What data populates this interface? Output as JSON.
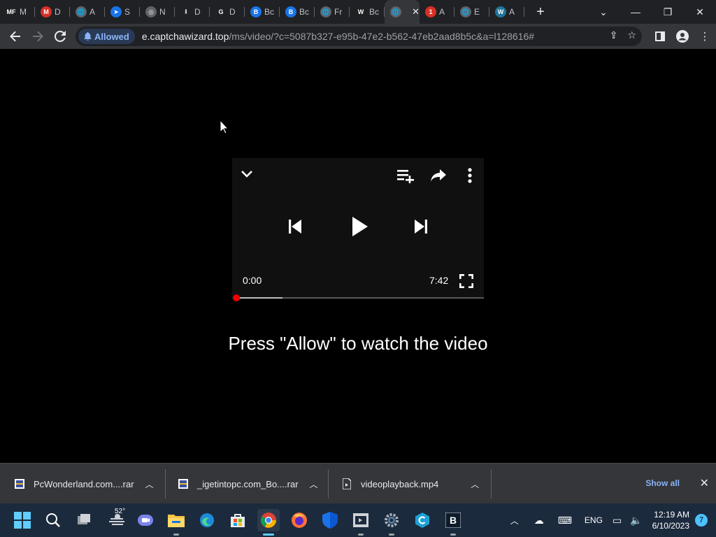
{
  "tabs": [
    {
      "title": "M",
      "icon": "mf-logo-icon",
      "favColor": "#202124",
      "favText": "MF"
    },
    {
      "title": "D",
      "icon": "m-logo-icon",
      "favColor": "#d93025",
      "favText": "M"
    },
    {
      "title": "A",
      "icon": "globe-icon",
      "favColor": "#5f6368",
      "favText": "🌐"
    },
    {
      "title": "S",
      "icon": "arrow-logo-icon",
      "favColor": "#1a73e8",
      "favText": "➤"
    },
    {
      "title": "N",
      "icon": "chrome-icon",
      "favColor": "#5f6368",
      "favText": "◎"
    },
    {
      "title": "D",
      "icon": "download-icon",
      "favColor": "#202124",
      "favText": "⭳"
    },
    {
      "title": "D",
      "icon": "g-logo-icon",
      "favColor": "#202124",
      "favText": "G"
    },
    {
      "title": "Bc",
      "icon": "b-shield-icon",
      "favColor": "#1a73e8",
      "favText": "B"
    },
    {
      "title": "Bc",
      "icon": "b-shield-icon",
      "favColor": "#1a73e8",
      "favText": "B"
    },
    {
      "title": "Fr",
      "icon": "globe-icon",
      "favColor": "#5f6368",
      "favText": "🌐"
    },
    {
      "title": "Bc",
      "icon": "w-logo-icon",
      "favColor": "#202124",
      "favText": "W"
    },
    {
      "title": "",
      "icon": "globe-icon",
      "favColor": "#5f6368",
      "favText": "🌐",
      "active": true
    },
    {
      "title": "A",
      "icon": "notification-badge-icon",
      "favColor": "#d93025",
      "favText": "1"
    },
    {
      "title": "E",
      "icon": "globe-icon",
      "favColor": "#5f6368",
      "favText": "🌐"
    },
    {
      "title": "A",
      "icon": "wordpress-icon",
      "favColor": "#21759b",
      "favText": "W"
    }
  ],
  "toolbar": {
    "permission_chip": "Allowed",
    "url_host": "e.captchawizard.top",
    "url_path": "/ms/video/?c=5087b327-e95b-47e2-b562-47eb2aad8b5c&a=l128616#"
  },
  "player": {
    "current_time": "0:00",
    "duration": "7:42",
    "buffered_fraction": 0.19
  },
  "prompt": "Press \"Allow\" to watch the video",
  "downloads": {
    "items": [
      {
        "name": "PcWonderland.com....rar",
        "icon": "winrar-icon"
      },
      {
        "name": "_igetintopc.com_Bo....rar",
        "icon": "winrar-icon"
      },
      {
        "name": "videoplayback.mp4",
        "icon": "video-file-icon"
      }
    ],
    "show_all": "Show all"
  },
  "taskbar": {
    "weather_temp": "52°",
    "language": "ENG",
    "time": "12:19 AM",
    "date": "6/10/2023",
    "notification_count": "7"
  }
}
